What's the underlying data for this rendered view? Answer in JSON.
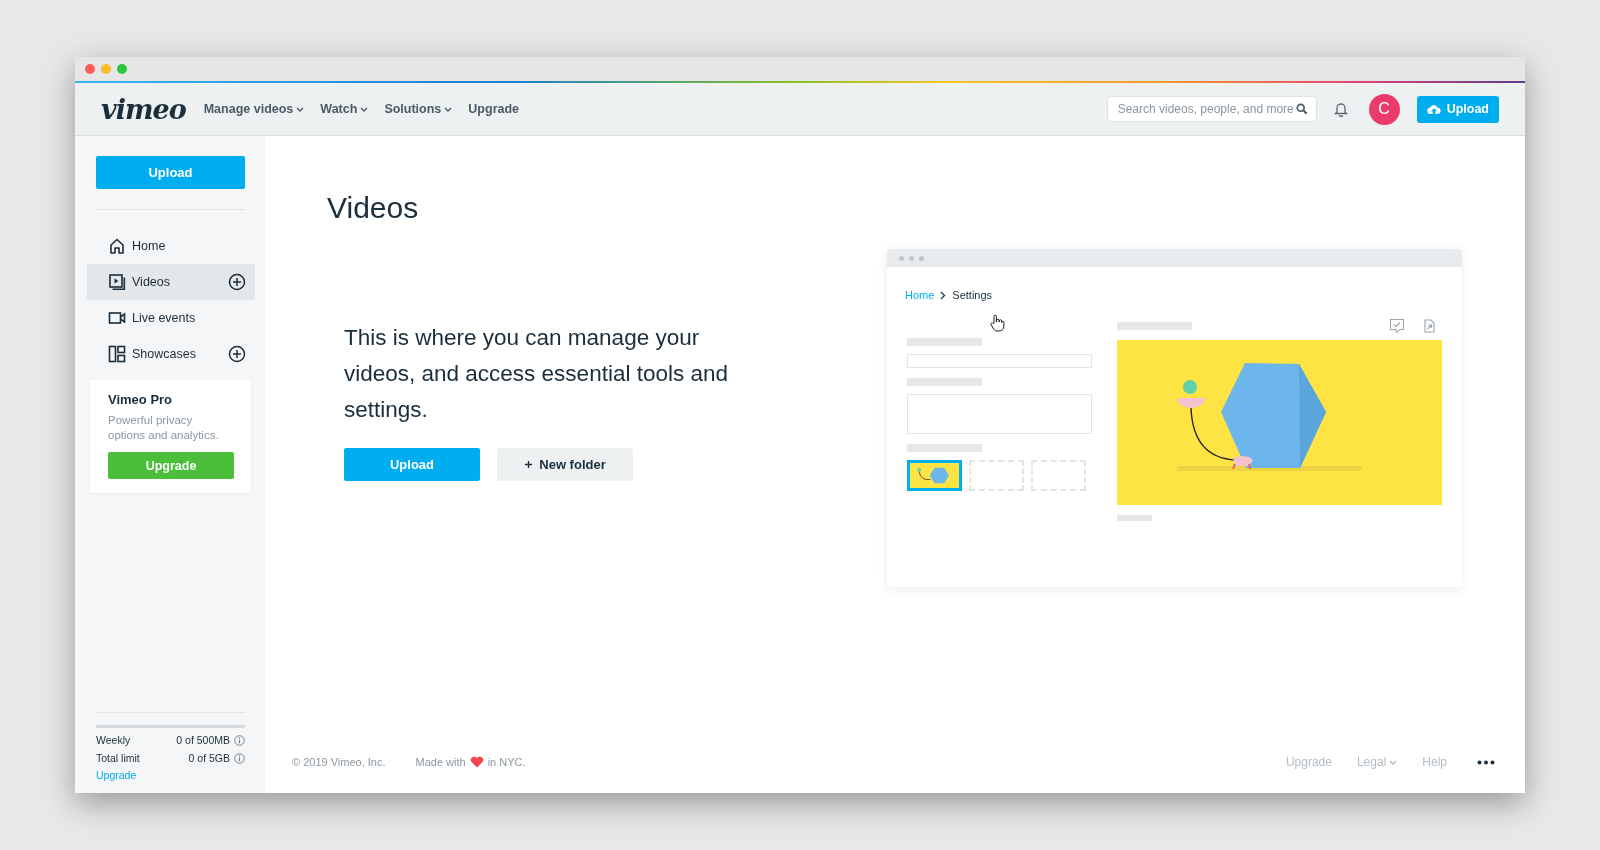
{
  "header": {
    "logo": "vimeo",
    "menu": [
      {
        "label": "Manage videos",
        "dropdown": true
      },
      {
        "label": "Watch",
        "dropdown": true
      },
      {
        "label": "Solutions",
        "dropdown": true
      },
      {
        "label": "Upgrade",
        "dropdown": false
      }
    ],
    "search": {
      "placeholder": "Search videos, people, and more"
    },
    "avatar": "C",
    "upload": "Upload"
  },
  "sidebar": {
    "upload": "Upload",
    "items": [
      {
        "label": "Home",
        "kind": "home",
        "selected": false,
        "addable": false
      },
      {
        "label": "Videos",
        "kind": "videos",
        "selected": true,
        "addable": true
      },
      {
        "label": "Live events",
        "kind": "live",
        "selected": false,
        "addable": false
      },
      {
        "label": "Showcases",
        "kind": "showcases",
        "selected": false,
        "addable": true
      }
    ],
    "promo": {
      "title": "Vimeo Pro",
      "text": "Powerful privacy options and analytics.",
      "button": "Upgrade"
    },
    "storage": {
      "level": 0,
      "rows": [
        {
          "label": "Weekly",
          "value": "0 of 500MB"
        },
        {
          "label": "Total limit",
          "value": "0 of 5GB"
        }
      ],
      "link": "Upgrade"
    }
  },
  "main": {
    "title": "Videos",
    "description": "This is where you can manage your videos, and access essential tools and settings.",
    "buttons": [
      {
        "label": "Upload",
        "kind": "primary"
      },
      {
        "label": "New folder",
        "kind": "add"
      }
    ],
    "mockup": {
      "breadcrumb": [
        "Home",
        "Settings"
      ],
      "thumbnails": [
        {
          "selected": true
        },
        {
          "selected": false
        },
        {
          "selected": false
        }
      ]
    }
  },
  "footer": {
    "copyright": "© 2019 Vimeo, Inc.",
    "made_with": "Made with",
    "made_in": "in NYC.",
    "links": [
      {
        "label": "Upgrade",
        "dropdown": false
      },
      {
        "label": "Legal",
        "dropdown": true
      },
      {
        "label": "Help",
        "dropdown": false
      }
    ]
  }
}
